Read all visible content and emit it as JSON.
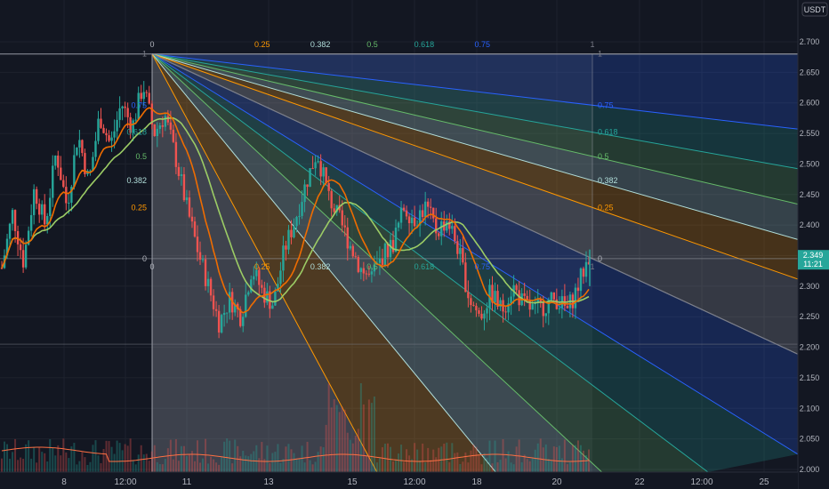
{
  "chart_data": {
    "type": "candlestick",
    "symbol_quote": "USDT",
    "y_axis": {
      "ticks": [
        "2.700",
        "2.650",
        "2.600",
        "2.550",
        "2.500",
        "2.450",
        "2.400",
        "2.350",
        "2.300",
        "2.250",
        "2.200",
        "2.150",
        "2.100",
        "2.050",
        "2.000"
      ],
      "ylim": [
        2.0,
        2.72
      ]
    },
    "x_axis": {
      "ticks": [
        "8",
        "12:00",
        "11",
        "13",
        "15",
        "12:00",
        "18",
        "20",
        "22",
        "12:00",
        "25"
      ]
    },
    "last_price": {
      "value": "2.349",
      "countdown": "11:21",
      "color": "#26a69a"
    },
    "price_path": [
      [
        2.33,
        2.42,
        2.34,
        2.46,
        2.4,
        2.52,
        2.43,
        2.55,
        2.47,
        2.58,
        2.53,
        2.6,
        2.56,
        2.63,
        2.55,
        2.58,
        2.51,
        2.43,
        2.36,
        2.3,
        2.24,
        2.28,
        2.25,
        2.33,
        2.29,
        2.27,
        2.36,
        2.41,
        2.47,
        2.52,
        2.45,
        2.41,
        2.37,
        2.33,
        2.31,
        2.35,
        2.37,
        2.43,
        2.41,
        2.43,
        2.39,
        2.41,
        2.36,
        2.28,
        2.25,
        2.29,
        2.26,
        2.3,
        2.27,
        2.26,
        2.27,
        2.28,
        2.26,
        2.3,
        2.35
      ]
    ],
    "moving_averages": [
      {
        "name": "",
        "color": "#9ccc65"
      },
      {
        "name": "",
        "color": "#ef6c00"
      }
    ],
    "fib_fan_levels": [
      "1",
      "0.75",
      "0.618",
      "0.5",
      "0.382",
      "0.25",
      "0"
    ],
    "fib_level_colors": {
      "1": "#787b86",
      "0.75": "#2962ff",
      "0.618": "#26a69a",
      "0.5": "#66bb6a",
      "0.382": "#b2dfdb",
      "0.25": "#ff9800",
      "0": "#b2b5be"
    },
    "fib_fan_points": {
      "start": {
        "x_label": "11",
        "price": 2.68
      },
      "end_price": 2.345
    },
    "volume_line_color": "#ff7043",
    "grid": true,
    "legend": "none"
  }
}
